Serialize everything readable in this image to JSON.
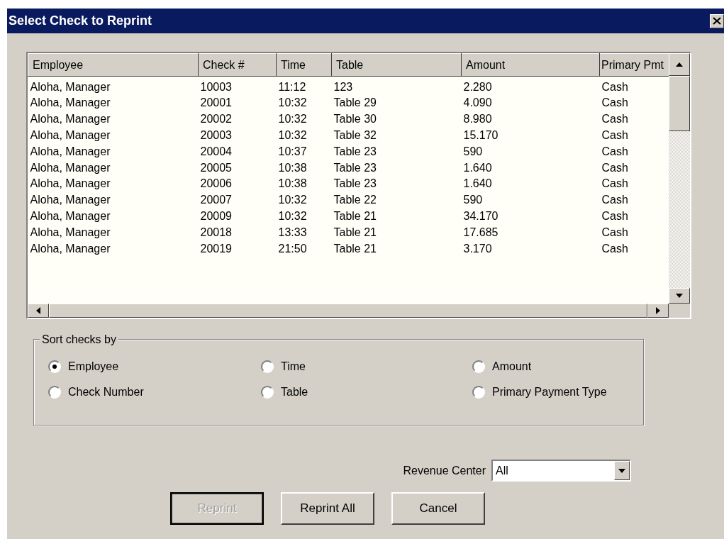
{
  "window": {
    "title": "Select Check to Reprint"
  },
  "table": {
    "columns": [
      "Employee",
      "Check #",
      "Time",
      "Table",
      "Amount",
      "Primary Pmt"
    ],
    "rows": [
      [
        "Aloha, Manager",
        "10003",
        "11:12",
        "123",
        "2.280",
        "Cash"
      ],
      [
        "Aloha, Manager",
        "20001",
        "10:32",
        "Table 29",
        "4.090",
        "Cash"
      ],
      [
        "Aloha, Manager",
        "20002",
        "10:32",
        "Table 30",
        "8.980",
        "Cash"
      ],
      [
        "Aloha, Manager",
        "20003",
        "10:32",
        "Table 32",
        "15.170",
        "Cash"
      ],
      [
        "Aloha, Manager",
        "20004",
        "10:37",
        "Table 23",
        "590",
        "Cash"
      ],
      [
        "Aloha, Manager",
        "20005",
        "10:38",
        "Table 23",
        "1.640",
        "Cash"
      ],
      [
        "Aloha, Manager",
        "20006",
        "10:38",
        "Table 23",
        "1.640",
        "Cash"
      ],
      [
        "Aloha, Manager",
        "20007",
        "10:32",
        "Table 22",
        "590",
        "Cash"
      ],
      [
        "Aloha, Manager",
        "20009",
        "10:32",
        "Table 21",
        "34.170",
        "Cash"
      ],
      [
        "Aloha, Manager",
        "20018",
        "13:33",
        "Table 21",
        "17.685",
        "Cash"
      ],
      [
        "Aloha, Manager",
        "20019",
        "21:50",
        "Table 21",
        "3.170",
        "Cash"
      ]
    ]
  },
  "sort_group": {
    "title": "Sort checks by",
    "options": [
      {
        "label": "Employee",
        "selected": true
      },
      {
        "label": "Time",
        "selected": false
      },
      {
        "label": "Amount",
        "selected": false
      },
      {
        "label": "Check Number",
        "selected": false
      },
      {
        "label": "Table",
        "selected": false
      },
      {
        "label": "Primary Payment Type",
        "selected": false
      }
    ]
  },
  "revenue_center": {
    "label": "Revenue Center",
    "value": "All"
  },
  "buttons": [
    {
      "label": "Reprint",
      "disabled": true
    },
    {
      "label": "Reprint All",
      "disabled": false
    },
    {
      "label": "Cancel",
      "disabled": false
    }
  ]
}
